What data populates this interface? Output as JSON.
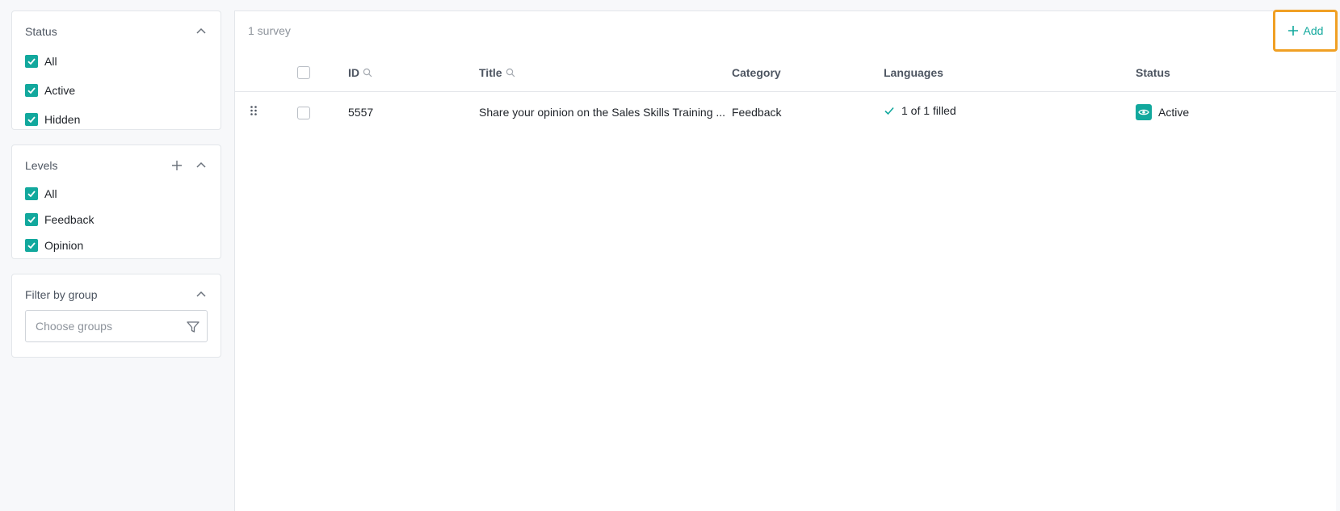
{
  "sidebar": {
    "status": {
      "title": "Status",
      "items": [
        {
          "label": "All"
        },
        {
          "label": "Active"
        },
        {
          "label": "Hidden"
        }
      ]
    },
    "levels": {
      "title": "Levels",
      "items": [
        {
          "label": "All"
        },
        {
          "label": "Feedback"
        },
        {
          "label": "Opinion"
        }
      ]
    },
    "groups": {
      "title": "Filter by group",
      "placeholder": "Choose groups"
    }
  },
  "main": {
    "count": "1 survey",
    "add_label": "Add",
    "columns": {
      "id": "ID",
      "title": "Title",
      "category": "Category",
      "languages": "Languages",
      "status": "Status"
    },
    "rows": [
      {
        "id": "5557",
        "title": "Share your opinion on the Sales Skills Training ...",
        "category": "Feedback",
        "languages": "1 of 1 filled",
        "status": "Active"
      }
    ]
  },
  "colors": {
    "accent": "#12a89d",
    "highlight": "#f0a024",
    "background": "#f7f8fa"
  }
}
